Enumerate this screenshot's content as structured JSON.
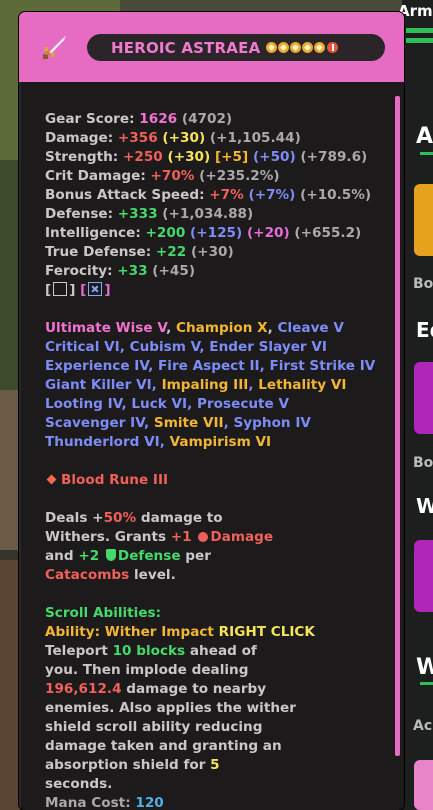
{
  "side_panel": {
    "top_label": "Armor",
    "heading_1": "A",
    "row_label_1": "Bo",
    "heading_2": "Eq",
    "row_label_2": "Bo",
    "heading_3": "W",
    "heading_4": "W",
    "row_label_3": "Ac"
  },
  "tooltip": {
    "item_name": "HEROIC ASTRAEA",
    "stars": 5,
    "master_stars": 1,
    "stats": [
      {
        "label": "Gear Score: ",
        "value": "1626",
        "extra": " (4702)"
      },
      {
        "label": "Damage: ",
        "value": "+356",
        "bonus": " (+30)",
        "extra": " (+1,105.44)"
      },
      {
        "label": "Strength: ",
        "value": "+250",
        "bonus": " (+30)",
        "bonus2": " [+5]",
        "bonus3": " (+50)",
        "extra": " (+789.6)"
      },
      {
        "label": "Crit Damage: ",
        "value": "+70%",
        "extra": " (+235.2%)"
      },
      {
        "label": "Bonus Attack Speed: ",
        "value": "+7%",
        "bonus": " (+7%)",
        "extra": " (+10.5%)"
      },
      {
        "label": "Defense: ",
        "value": "+333",
        "extra": " (+1,034.88)"
      },
      {
        "label": "Intelligence: ",
        "value": "+200",
        "bonus": " (+125)",
        "bonus2": " (+20)",
        "extra": " (+655.2)"
      },
      {
        "label": "True Defense: ",
        "value": "+22",
        "extra": " (+30)"
      },
      {
        "label": "Ferocity: ",
        "value": "+33",
        "extra": " (+45)"
      }
    ],
    "enchant_lines": [
      [
        [
          "Ultimate Wise V",
          "c-pink"
        ],
        [
          ", ",
          "c-gray"
        ],
        [
          "Champion X",
          "c-gold"
        ],
        [
          ", ",
          "c-gray"
        ],
        [
          "Cleave V",
          "c-blue"
        ]
      ],
      [
        [
          "Critical VI, Cubism V, Ender Slayer VI",
          "c-blue"
        ]
      ],
      [
        [
          "Experience IV, Fire Aspect II, First Strike IV",
          "c-blue"
        ]
      ],
      [
        [
          "Giant Killer VI",
          "c-blue"
        ],
        [
          ", ",
          "c-blue"
        ],
        [
          "Impaling III",
          "c-gold"
        ],
        [
          ", ",
          "c-blue"
        ],
        [
          "Lethality VI",
          "c-gold"
        ]
      ],
      [
        [
          "Looting IV, Luck VI, Prosecute V",
          "c-blue"
        ]
      ],
      [
        [
          "Scavenger IV",
          "c-blue"
        ],
        [
          ", ",
          "c-blue"
        ],
        [
          "Smite VII",
          "c-gold"
        ],
        [
          ", ",
          "c-blue"
        ],
        [
          "Syphon IV",
          "c-blue"
        ]
      ],
      [
        [
          "Thunderlord VI",
          "c-blue"
        ],
        [
          ", ",
          "c-blue"
        ],
        [
          "Vampirism VI",
          "c-gold"
        ]
      ]
    ],
    "rune": "Blood Rune III",
    "reforge": {
      "line1_a": "Deals +",
      "line1_b": "50%",
      "line1_c": " damage to",
      "line2_a": "Withers. Grants ",
      "line2_b": "+1 ",
      "line2_c": "Damage",
      "line3_a": "and ",
      "line3_b": "+2 ",
      "line3_c": "Defense",
      "line3_d": " per",
      "line4_a": "Catacombs",
      "line4_b": " level."
    },
    "ability": {
      "header": "Scroll Abilities:",
      "name": "Ability: Wither Impact ",
      "action": "RIGHT CLICK",
      "l1_a": "Teleport ",
      "l1_b": "10 blocks",
      "l1_c": " ahead of",
      "l2": "you. Then implode dealing",
      "l3_a": "196,612.4",
      "l3_b": " damage to nearby",
      "l4": "enemies. Also applies the wither",
      "l5": "shield scroll ability reducing",
      "l6": "damage taken and granting an",
      "l7_a": "absorption shield for ",
      "l7_b": "5",
      "l8": "seconds.",
      "mana_label": "Mana Cost: ",
      "mana_value": "120"
    }
  },
  "colors": {
    "rarity": "#e66bc2",
    "tooltip_bg": "#1c1a1b",
    "accent_green": "#2fbf5a"
  }
}
